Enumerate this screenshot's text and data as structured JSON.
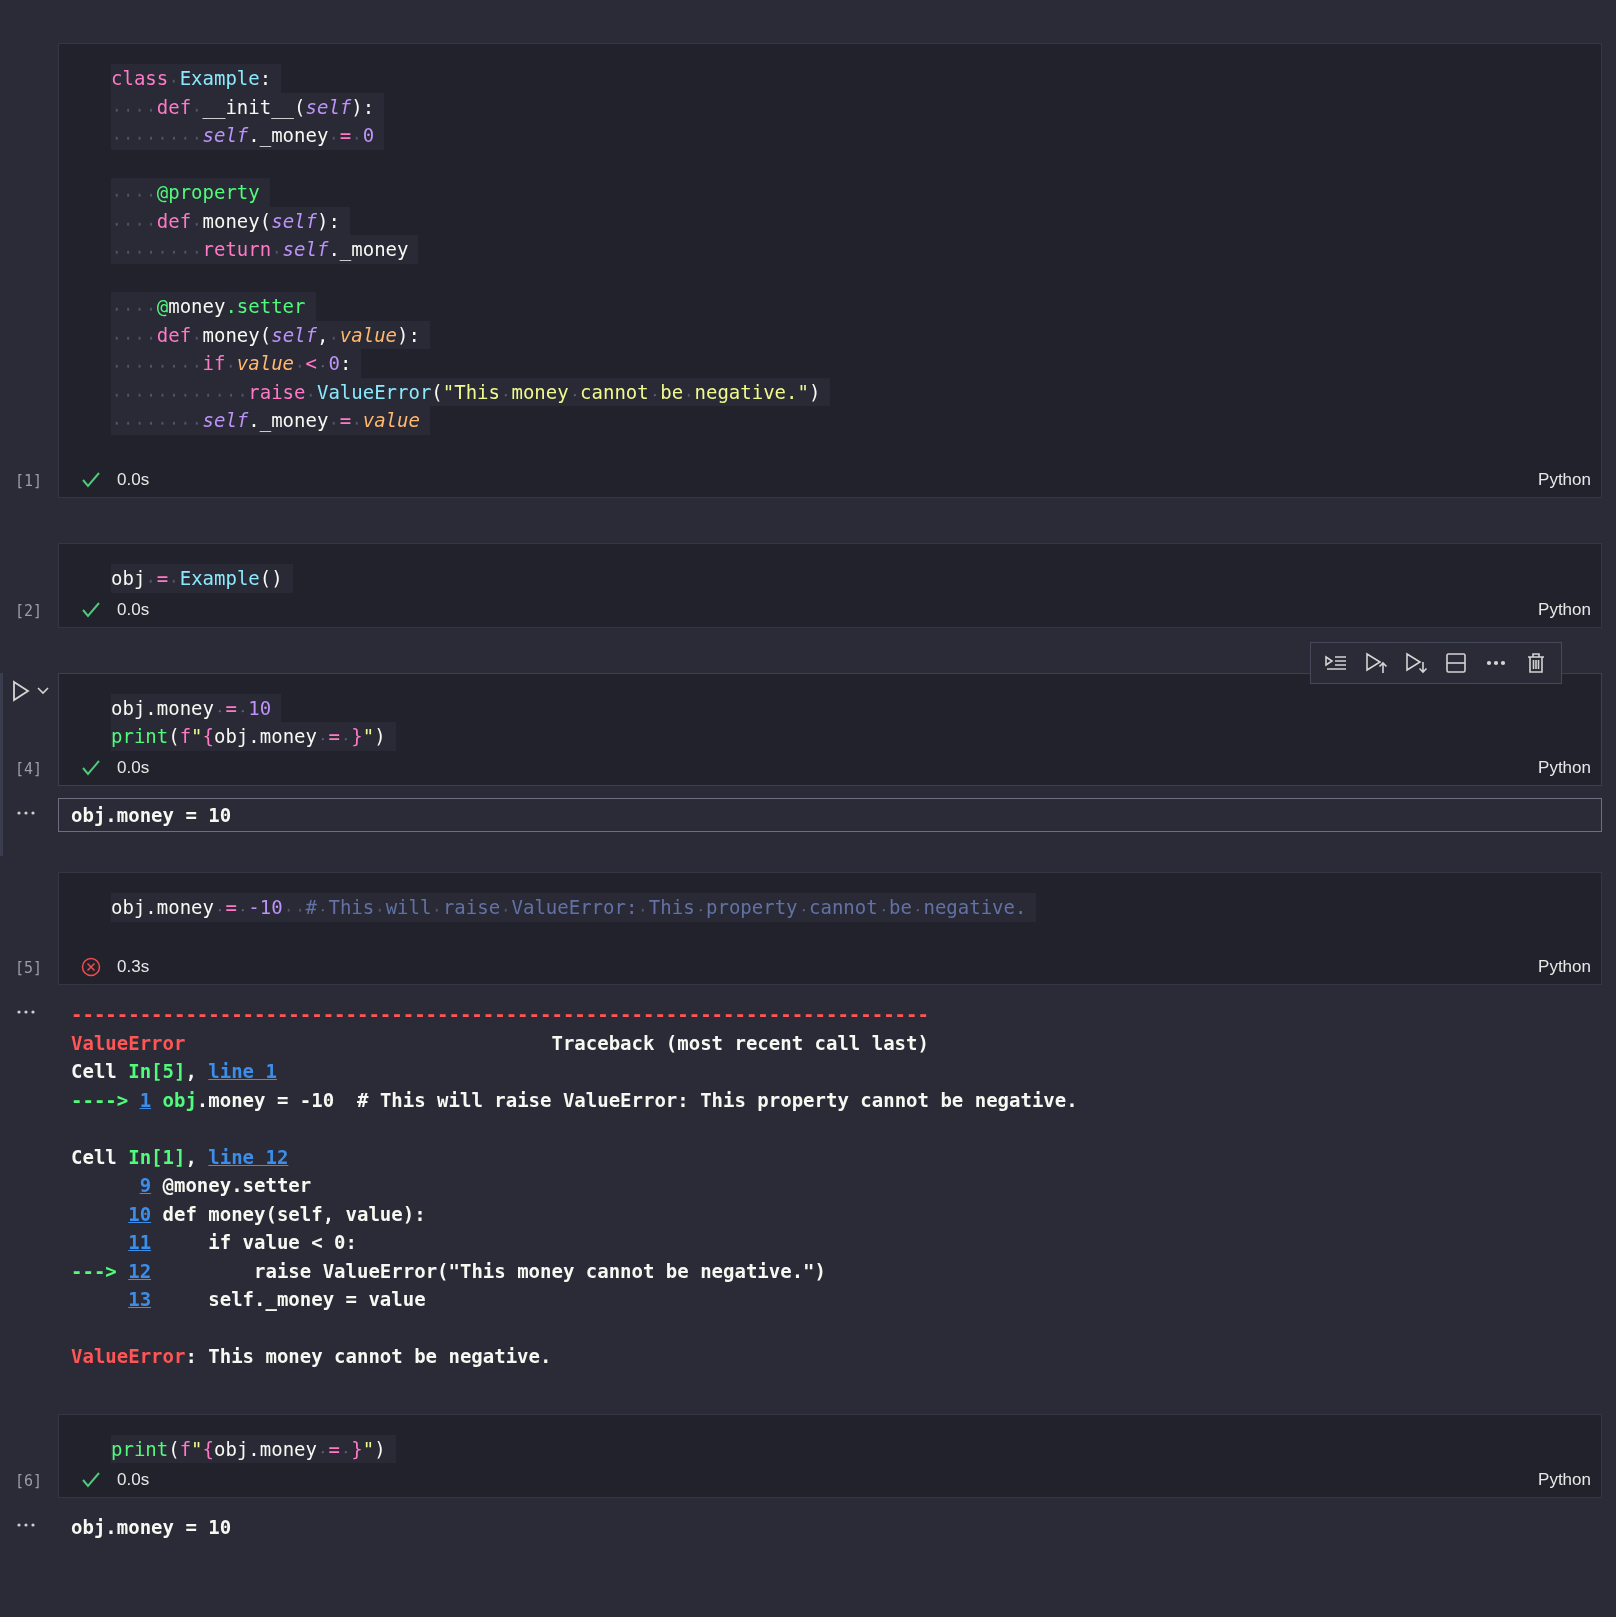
{
  "cells": [
    {
      "count": "[1]",
      "result": {
        "kind": "success",
        "time": "0.0s"
      },
      "language": "Python",
      "focused": false,
      "lines": [
        {
          "kind": "code",
          "tokens": [
            {
              "text": "class",
              "kind": "keyword"
            },
            {
              "text": " Example",
              "kind": "type"
            },
            {
              "text": ":",
              "kind": "plain"
            }
          ]
        },
        {
          "kind": "code",
          "tokens": [
            {
              "text": "    def",
              "kind": "keyword"
            },
            {
              "text": " __init__(",
              "kind": "plain"
            },
            {
              "text": "self",
              "kind": "self"
            },
            {
              "text": "):",
              "kind": "plain"
            }
          ]
        },
        {
          "kind": "code",
          "tokens": [
            {
              "text": "        self",
              "kind": "self"
            },
            {
              "text": "._money ",
              "kind": "plain"
            },
            {
              "text": "=",
              "kind": "operator"
            },
            {
              "text": " 0",
              "kind": "number"
            }
          ]
        },
        {
          "kind": "blank"
        },
        {
          "kind": "code",
          "tokens": [
            {
              "text": "    @property",
              "kind": "decorator"
            }
          ]
        },
        {
          "kind": "code",
          "tokens": [
            {
              "text": "    def",
              "kind": "keyword"
            },
            {
              "text": " money(",
              "kind": "plain"
            },
            {
              "text": "self",
              "kind": "self"
            },
            {
              "text": "):",
              "kind": "plain"
            }
          ]
        },
        {
          "kind": "code",
          "tokens": [
            {
              "text": "        return",
              "kind": "keyword"
            },
            {
              "text": " self",
              "kind": "self"
            },
            {
              "text": "._money",
              "kind": "plain"
            }
          ]
        },
        {
          "kind": "blank"
        },
        {
          "kind": "code",
          "tokens": [
            {
              "text": "    @",
              "kind": "decorator"
            },
            {
              "text": "money",
              "kind": "plain"
            },
            {
              "text": ".setter",
              "kind": "decorator"
            }
          ]
        },
        {
          "kind": "code",
          "tokens": [
            {
              "text": "    def",
              "kind": "keyword"
            },
            {
              "text": " money(",
              "kind": "plain"
            },
            {
              "text": "self",
              "kind": "self"
            },
            {
              "text": ", ",
              "kind": "plain"
            },
            {
              "text": "value",
              "kind": "param"
            },
            {
              "text": "):",
              "kind": "plain"
            }
          ]
        },
        {
          "kind": "code",
          "tokens": [
            {
              "text": "        if",
              "kind": "keyword"
            },
            {
              "text": " value",
              "kind": "param"
            },
            {
              "text": " <",
              "kind": "operator"
            },
            {
              "text": " 0",
              "kind": "number"
            },
            {
              "text": ":",
              "kind": "plain"
            }
          ]
        },
        {
          "kind": "code",
          "tokens": [
            {
              "text": "            raise",
              "kind": "keyword"
            },
            {
              "text": " ValueError",
              "kind": "type"
            },
            {
              "text": "(",
              "kind": "plain"
            },
            {
              "text": "\"This money cannot be negative.\"",
              "kind": "string"
            },
            {
              "text": ")",
              "kind": "plain"
            }
          ]
        },
        {
          "kind": "code",
          "tokens": [
            {
              "text": "        self",
              "kind": "self"
            },
            {
              "text": "._money ",
              "kind": "plain"
            },
            {
              "text": "=",
              "kind": "operator"
            },
            {
              "text": " value",
              "kind": "param"
            }
          ]
        },
        {
          "kind": "blank"
        }
      ]
    },
    {
      "count": "[2]",
      "result": {
        "kind": "success",
        "time": "0.0s"
      },
      "language": "Python",
      "focused": false,
      "lines": [
        {
          "kind": "code",
          "tokens": [
            {
              "text": "obj ",
              "kind": "plain"
            },
            {
              "text": "=",
              "kind": "operator"
            },
            {
              "text": " Example",
              "kind": "type"
            },
            {
              "text": "()",
              "kind": "plain"
            }
          ]
        }
      ]
    },
    {
      "count": "[4]",
      "result": {
        "kind": "success",
        "time": "0.0s"
      },
      "language": "Python",
      "focused": true,
      "lines": [
        {
          "kind": "code",
          "tokens": [
            {
              "text": "obj.money ",
              "kind": "plain"
            },
            {
              "text": "=",
              "kind": "operator"
            },
            {
              "text": " 10",
              "kind": "number"
            }
          ]
        },
        {
          "kind": "code",
          "tokens": [
            {
              "text": "print",
              "kind": "function"
            },
            {
              "text": "(",
              "kind": "plain"
            },
            {
              "text": "f",
              "kind": "keyword"
            },
            {
              "text": "\"",
              "kind": "string"
            },
            {
              "text": "{",
              "kind": "keyword"
            },
            {
              "text": "obj.money ",
              "kind": "plain"
            },
            {
              "text": "=",
              "kind": "operator"
            },
            {
              "text": " }",
              "kind": "keyword"
            },
            {
              "text": "\"",
              "kind": "string"
            },
            {
              "text": ")",
              "kind": "plain"
            }
          ]
        }
      ],
      "output": {
        "focused": true,
        "lines": [
          {
            "kind": "code",
            "tokens": [
              {
                "text": "obj.money = 10",
                "kind": "plain"
              }
            ]
          }
        ]
      }
    },
    {
      "count": "[5]",
      "result": {
        "kind": "error",
        "time": "0.3s"
      },
      "language": "Python",
      "focused": false,
      "lines": [
        {
          "kind": "code",
          "tokens": [
            {
              "text": "obj.money ",
              "kind": "plain"
            },
            {
              "text": "=",
              "kind": "operator"
            },
            {
              "text": " -10",
              "kind": "number"
            },
            {
              "text": "  # This will raise ValueError: This property cannot be negative.",
              "kind": "comment"
            }
          ]
        },
        {
          "kind": "blank"
        }
      ],
      "output": {
        "lines": [
          {
            "kind": "code",
            "tokens": [
              {
                "text": "---------------------------------------------------------------------------",
                "kind": "error"
              }
            ]
          },
          {
            "kind": "code",
            "tokens": [
              {
                "text": "ValueError",
                "kind": "error"
              },
              {
                "text": "                                Traceback (most recent call last)",
                "kind": "plain"
              }
            ]
          },
          {
            "kind": "code",
            "tokens": [
              {
                "text": "Cell ",
                "kind": "plain"
              },
              {
                "text": "In[5]",
                "kind": "green"
              },
              {
                "text": ", ",
                "kind": "plain"
              },
              {
                "text": "line 1",
                "kind": "link"
              }
            ]
          },
          {
            "kind": "code",
            "tokens": [
              {
                "text": "----> ",
                "kind": "green"
              },
              {
                "text": "1",
                "kind": "link"
              },
              {
                "text": " obj",
                "kind": "green"
              },
              {
                "text": ".money = -10  # This will raise ValueError: This property cannot be negative.",
                "kind": "plain"
              }
            ]
          },
          {
            "kind": "blank"
          },
          {
            "kind": "code",
            "tokens": [
              {
                "text": "Cell ",
                "kind": "plain"
              },
              {
                "text": "In[1]",
                "kind": "green"
              },
              {
                "text": ", ",
                "kind": "plain"
              },
              {
                "text": "line 12",
                "kind": "link"
              }
            ]
          },
          {
            "kind": "code",
            "tokens": [
              {
                "text": "      9",
                "kind": "link"
              },
              {
                "text": " @money.setter",
                "kind": "plain"
              }
            ]
          },
          {
            "kind": "code",
            "tokens": [
              {
                "text": "     10",
                "kind": "link"
              },
              {
                "text": " def money(self, value):",
                "kind": "plain"
              }
            ]
          },
          {
            "kind": "code",
            "tokens": [
              {
                "text": "     11",
                "kind": "link"
              },
              {
                "text": "     if value < 0:",
                "kind": "plain"
              }
            ]
          },
          {
            "kind": "code",
            "tokens": [
              {
                "text": "---> ",
                "kind": "green"
              },
              {
                "text": "12",
                "kind": "link"
              },
              {
                "text": "         raise ValueError(\"This money cannot be negative.\")",
                "kind": "plain"
              }
            ]
          },
          {
            "kind": "code",
            "tokens": [
              {
                "text": "     13",
                "kind": "link"
              },
              {
                "text": "     self._money = value",
                "kind": "plain"
              }
            ]
          },
          {
            "kind": "blank"
          },
          {
            "kind": "code",
            "tokens": [
              {
                "text": "ValueError",
                "kind": "error"
              },
              {
                "text": ": This money cannot be negative.",
                "kind": "plain"
              }
            ]
          }
        ]
      }
    },
    {
      "count": "[6]",
      "result": {
        "kind": "success",
        "time": "0.0s"
      },
      "language": "Python",
      "focused": false,
      "lines": [
        {
          "kind": "code",
          "tokens": [
            {
              "text": "print",
              "kind": "function"
            },
            {
              "text": "(",
              "kind": "plain"
            },
            {
              "text": "f",
              "kind": "keyword"
            },
            {
              "text": "\"",
              "kind": "string"
            },
            {
              "text": "{",
              "kind": "keyword"
            },
            {
              "text": "obj.money ",
              "kind": "plain"
            },
            {
              "text": "=",
              "kind": "operator"
            },
            {
              "text": " }",
              "kind": "keyword"
            },
            {
              "text": "\"",
              "kind": "string"
            },
            {
              "text": ")",
              "kind": "plain"
            }
          ]
        }
      ],
      "output": {
        "lines": [
          {
            "kind": "code",
            "tokens": [
              {
                "text": "obj.money = 10",
                "kind": "plain"
              }
            ]
          }
        ]
      }
    }
  ]
}
